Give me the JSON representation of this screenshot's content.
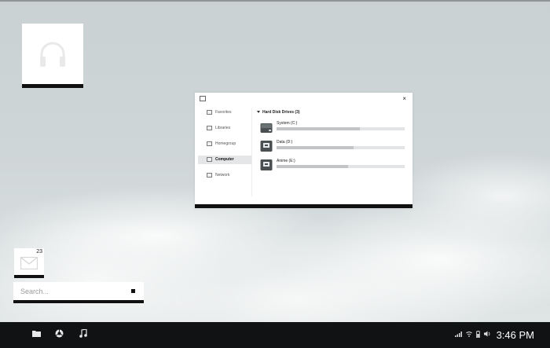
{
  "tiles": {
    "music": {
      "icon": "headphones-icon"
    },
    "mail": {
      "icon": "envelope-icon",
      "count": "23"
    }
  },
  "search": {
    "placeholder": "Search..."
  },
  "explorer": {
    "nav": [
      {
        "label": "Favorites",
        "icon": "star-folder-icon",
        "active": false
      },
      {
        "label": "Libraries",
        "icon": "library-icon",
        "active": false
      },
      {
        "label": "Homegroup",
        "icon": "homegroup-icon",
        "active": false
      },
      {
        "label": "Computer",
        "icon": "computer-icon",
        "active": true
      },
      {
        "label": "Network",
        "icon": "network-icon",
        "active": false
      }
    ],
    "section_title": "Hard Disk Drives (3)",
    "drives": [
      {
        "label": "System (C:)",
        "used_fraction": 0.65
      },
      {
        "label": "Data (D:)",
        "used_fraction": 0.6
      },
      {
        "label": "Anime (E:)",
        "used_fraction": 0.56
      }
    ],
    "close_label": "×"
  },
  "taskbar": {
    "icons": [
      "folder-icon",
      "browser-icon",
      "music-note-icon"
    ],
    "tray": [
      "signal-icon",
      "wifi-icon",
      "battery-icon",
      "volume-icon"
    ],
    "clock": "3:46 PM"
  }
}
